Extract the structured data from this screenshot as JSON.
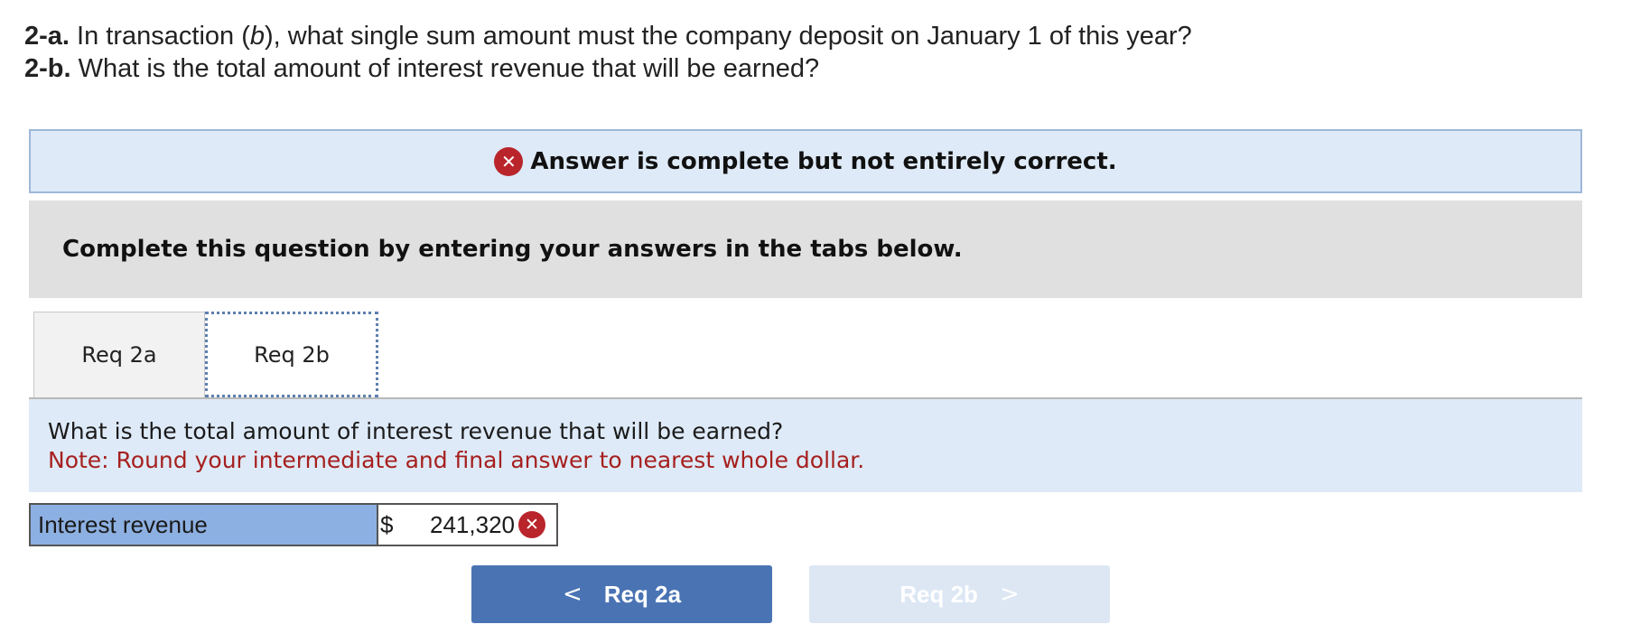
{
  "question": {
    "part_a_prefix": "2-a.",
    "part_a_text_1": " In transaction (",
    "part_a_italic": "b",
    "part_a_text_2": "), what single sum amount must the company deposit on January 1 of this year?",
    "part_b_prefix": "2-b.",
    "part_b_text": " What is the total amount of interest revenue that will be earned?"
  },
  "feedback_banner": {
    "icon": "x-circle-icon",
    "text": "Answer is complete but not entirely correct.",
    "status_color": "#b9252b"
  },
  "instructions": "Complete this question by entering your answers in the tabs below.",
  "tabs": [
    {
      "label": "Req 2a",
      "active": false
    },
    {
      "label": "Req 2b",
      "active": true
    }
  ],
  "prompt": {
    "question": "What is the total amount of interest revenue that will be earned?",
    "note": "Note: Round your intermediate and final answer to nearest whole dollar."
  },
  "answer": {
    "label": "Interest revenue",
    "currency": "$",
    "value": "241,320",
    "status": "incorrect",
    "status_icon": "x-circle-icon"
  },
  "navigation": {
    "prev_label": "Req 2a",
    "prev_icon": "chevron-left-icon",
    "next_label": "Req 2b",
    "next_icon": "chevron-right-icon",
    "next_enabled": false
  },
  "colors": {
    "accent": "#4a73b4",
    "banner_bg": "#deeaf7",
    "note_red": "#a6201f",
    "label_bg": "#8db0e2"
  }
}
